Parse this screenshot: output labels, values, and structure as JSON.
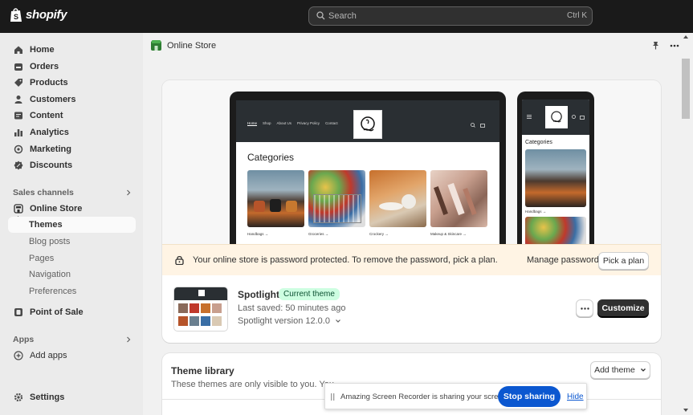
{
  "app": {
    "name": "shopify"
  },
  "search": {
    "placeholder": "Search",
    "shortcut": "Ctrl K"
  },
  "sidebar": {
    "main_items": [
      {
        "label": "Home",
        "icon": "home-icon"
      },
      {
        "label": "Orders",
        "icon": "orders-icon"
      },
      {
        "label": "Products",
        "icon": "tag-icon"
      },
      {
        "label": "Customers",
        "icon": "person-icon"
      },
      {
        "label": "Content",
        "icon": "content-icon"
      },
      {
        "label": "Analytics",
        "icon": "bar-chart-icon"
      },
      {
        "label": "Marketing",
        "icon": "target-icon"
      },
      {
        "label": "Discounts",
        "icon": "discount-icon"
      }
    ],
    "sales_channels_label": "Sales channels",
    "online_store": "Online Store",
    "sub_items": [
      {
        "label": "Themes",
        "active": true
      },
      {
        "label": "Blog posts"
      },
      {
        "label": "Pages"
      },
      {
        "label": "Navigation"
      },
      {
        "label": "Preferences"
      }
    ],
    "point_of_sale": "Point of Sale",
    "apps_label": "Apps",
    "add_apps": "Add apps",
    "settings": "Settings"
  },
  "page": {
    "title": "Online Store"
  },
  "preview": {
    "nav": [
      "Home",
      "Shop",
      "About Us",
      "Privacy Policy",
      "Contact"
    ],
    "categories_title": "Categories",
    "tiles": [
      {
        "label": "Handbags →"
      },
      {
        "label": "Groceries →"
      },
      {
        "label": "Crockery →"
      },
      {
        "label": "Makeup & Skincare →"
      }
    ]
  },
  "banner": {
    "message": "Your online store is password protected. To remove the password, pick a plan.",
    "manage_password": "Manage password",
    "pick_plan": "Pick a plan"
  },
  "theme": {
    "name": "Spotlight",
    "badge": "Current theme",
    "last_saved": "Last saved: 50 minutes ago",
    "version": "Spotlight version 12.0.0",
    "customize": "Customize"
  },
  "library": {
    "title": "Theme library",
    "description": "These themes are only visible to you. You",
    "add_theme": "Add theme"
  },
  "share_bar": {
    "message": "Amazing Screen Recorder is sharing your screen.",
    "stop": "Stop sharing",
    "hide": "Hide"
  },
  "colors": {
    "topbar": "#1a1a1a",
    "sidebar": "#ebebeb",
    "badge_bg": "#cdfee1",
    "banner_bg": "#fff4e4",
    "primary_button": "#303030",
    "share_button": "#0b57d0"
  }
}
